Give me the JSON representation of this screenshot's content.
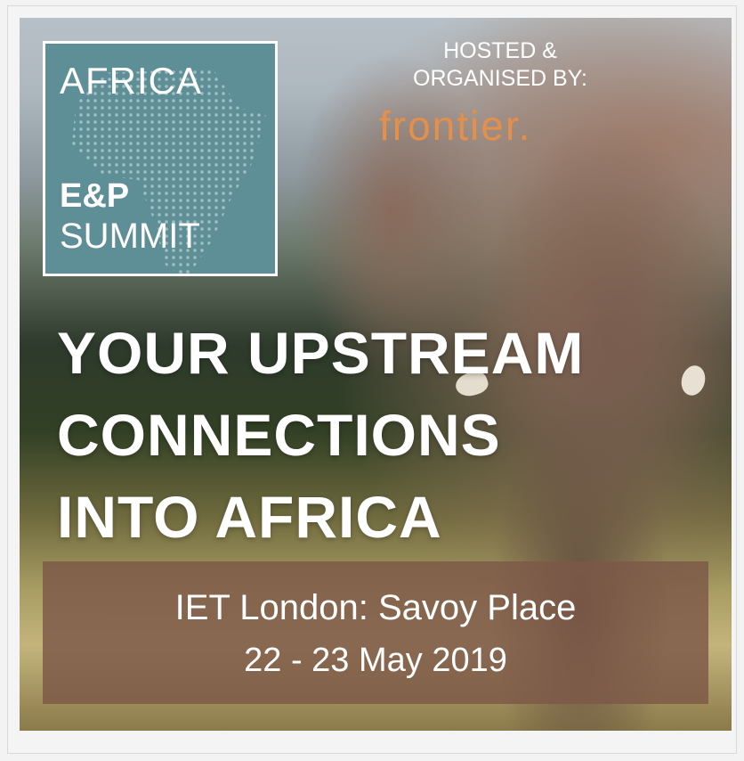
{
  "logo": {
    "line1": "AFRICA",
    "line2": "E&P",
    "line3": "SUMMIT",
    "background_color": "#5f8f96"
  },
  "host": {
    "label_line1": "HOSTED &",
    "label_line2": "ORGANISED BY:",
    "brand": "frontier.",
    "brand_color": "#e48f4a"
  },
  "headline": {
    "line1": "YOUR UPSTREAM",
    "line2": "CONNECTIONS",
    "line3": "INTO AFRICA"
  },
  "event": {
    "venue": "IET London: Savoy Place",
    "dates": "22 - 23 May 2019",
    "box_color": "#7d5848"
  }
}
